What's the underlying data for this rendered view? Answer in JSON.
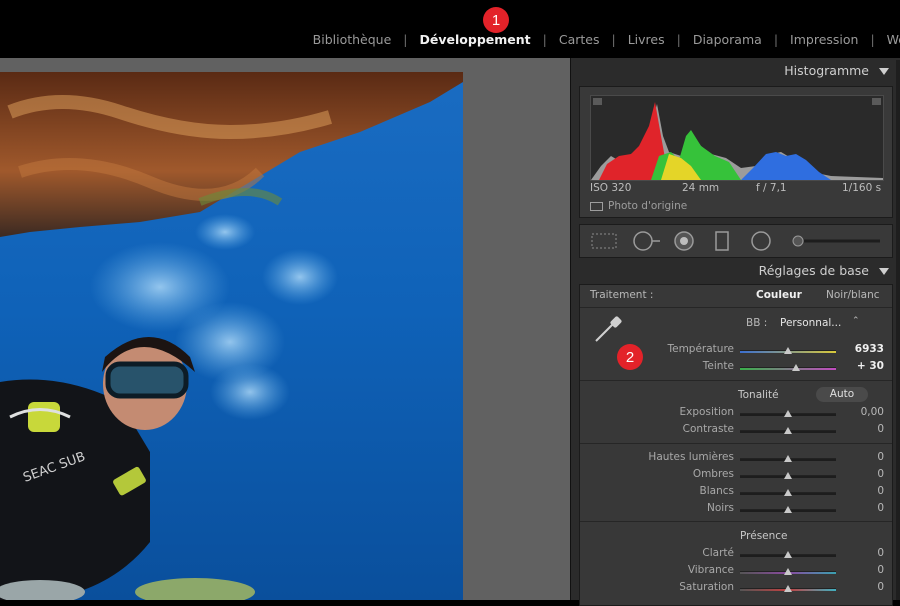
{
  "modules": {
    "items": [
      "Bibliothèque",
      "Développement",
      "Cartes",
      "Livres",
      "Diaporama",
      "Impression",
      "We"
    ],
    "active_index": 1
  },
  "badges": {
    "first": "1",
    "second": "2"
  },
  "histogram": {
    "title": "Histogramme",
    "iso": "ISO 320",
    "focal": "24 mm",
    "aperture": "f / 7,1",
    "shutter": "1/160 s",
    "original_label": "Photo d'origine"
  },
  "basic": {
    "title": "Réglages de base",
    "treatment_label": "Traitement :",
    "color_label": "Couleur",
    "bw_label": "Noir/blanc",
    "wb_label": "BB :",
    "wb_value": "Personnal...",
    "temperature_label": "Température",
    "temperature_value": "6933",
    "tint_label": "Teinte",
    "tint_value": "+ 30",
    "tonality_label": "Tonalité",
    "auto_label": "Auto",
    "exposure_label": "Exposition",
    "exposure_value": "0,00",
    "contrast_label": "Contraste",
    "contrast_value": "0",
    "highlights_label": "Hautes lumières",
    "highlights_value": "0",
    "shadows_label": "Ombres",
    "shadows_value": "0",
    "whites_label": "Blancs",
    "whites_value": "0",
    "blacks_label": "Noirs",
    "blacks_value": "0",
    "presence_label": "Présence",
    "clarity_label": "Clarté",
    "clarity_value": "0",
    "vibrance_label": "Vibrance",
    "vibrance_value": "0",
    "saturation_label": "Saturation",
    "saturation_value": "0"
  },
  "colors": {
    "badge": "#e32229",
    "panel": "#383838",
    "accent_text": "#f2f2f2"
  }
}
